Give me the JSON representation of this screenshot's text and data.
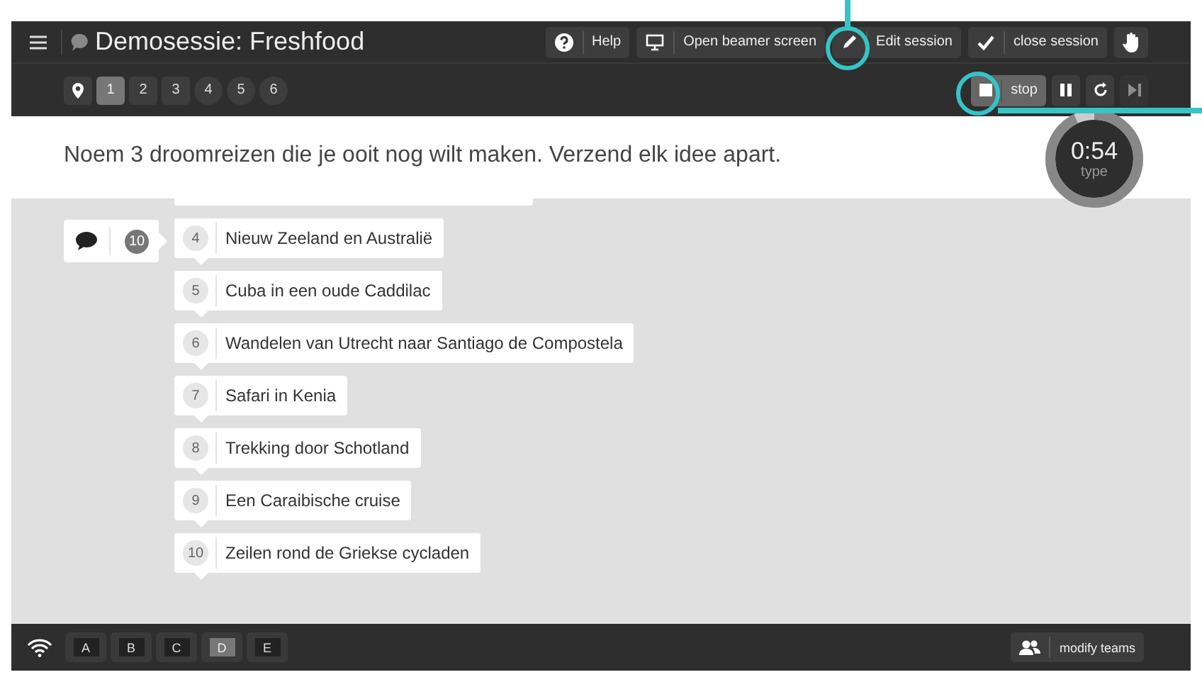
{
  "header": {
    "title": "Demosessie: Freshfood",
    "buttons": [
      {
        "kind": "help",
        "label": "Help"
      },
      {
        "kind": "beamer",
        "label": "Open beamer screen"
      },
      {
        "kind": "edit",
        "label": "Edit session"
      },
      {
        "kind": "close",
        "label": "close session"
      },
      {
        "kind": "hand"
      }
    ]
  },
  "questions": [
    {
      "label": "1",
      "selected": true,
      "kind": "square"
    },
    {
      "label": "2",
      "selected": false,
      "kind": "square"
    },
    {
      "label": "3",
      "selected": false,
      "kind": "square"
    },
    {
      "label": "4",
      "selected": false,
      "kind": "round"
    },
    {
      "label": "5",
      "selected": false,
      "kind": "round"
    },
    {
      "label": "6",
      "selected": false,
      "kind": "round"
    }
  ],
  "controls": {
    "stop_label": "stop"
  },
  "question": "Noem 3 droomreizen die je ooit nog wilt maken. Verzend elk idee apart.",
  "timer": {
    "time": "0:54",
    "caption": "type",
    "level": 0.93
  },
  "responses": {
    "count": "10",
    "items": [
      {
        "number": "4",
        "text": "Nieuw Zeeland en Australië"
      },
      {
        "number": "5",
        "text": "Cuba in een oude Caddilac"
      },
      {
        "number": "6",
        "text": "Wandelen van Utrecht naar Santiago de Compostela"
      },
      {
        "number": "7",
        "text": "Safari in Kenia"
      },
      {
        "number": "8",
        "text": "Trekking door Schotland"
      },
      {
        "number": "9",
        "text": "Een Caraibische cruise"
      },
      {
        "number": "10",
        "text": "Zeilen rond de Griekse cycladen"
      }
    ]
  },
  "teams": [
    {
      "label": "A",
      "selected": false
    },
    {
      "label": "B",
      "selected": false
    },
    {
      "label": "C",
      "selected": false
    },
    {
      "label": "D",
      "selected": true
    },
    {
      "label": "E",
      "selected": false
    }
  ],
  "modify_teams": "modify teams"
}
